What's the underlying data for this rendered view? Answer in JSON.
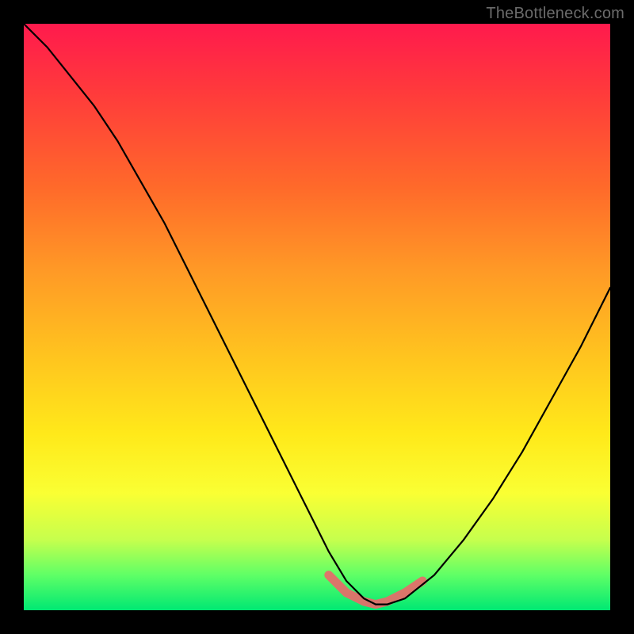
{
  "watermark": "TheBottleneck.com",
  "colors": {
    "frame": "#000000",
    "gradient_top": "#ff1a4d",
    "gradient_bottom": "#00e873",
    "curve": "#000000",
    "tolerance_band": "#e86a6a"
  },
  "chart_data": {
    "type": "line",
    "title": "",
    "xlabel": "",
    "ylabel": "",
    "xlim": [
      0,
      100
    ],
    "ylim": [
      0,
      100
    ],
    "grid": false,
    "legend": false,
    "series": [
      {
        "name": "bottleneck-curve",
        "x": [
          0,
          4,
          8,
          12,
          16,
          20,
          24,
          28,
          32,
          36,
          40,
          44,
          48,
          52,
          55,
          58,
          60,
          62,
          65,
          70,
          75,
          80,
          85,
          90,
          95,
          100
        ],
        "values": [
          100,
          96,
          91,
          86,
          80,
          73,
          66,
          58,
          50,
          42,
          34,
          26,
          18,
          10,
          5,
          2,
          1,
          1,
          2,
          6,
          12,
          19,
          27,
          36,
          45,
          55
        ]
      }
    ],
    "annotations": [
      {
        "name": "tolerance-band",
        "x": [
          52,
          55,
          58,
          60,
          62,
          65,
          68
        ],
        "values": [
          6,
          3,
          1.5,
          1,
          1.5,
          3,
          5
        ]
      }
    ]
  }
}
